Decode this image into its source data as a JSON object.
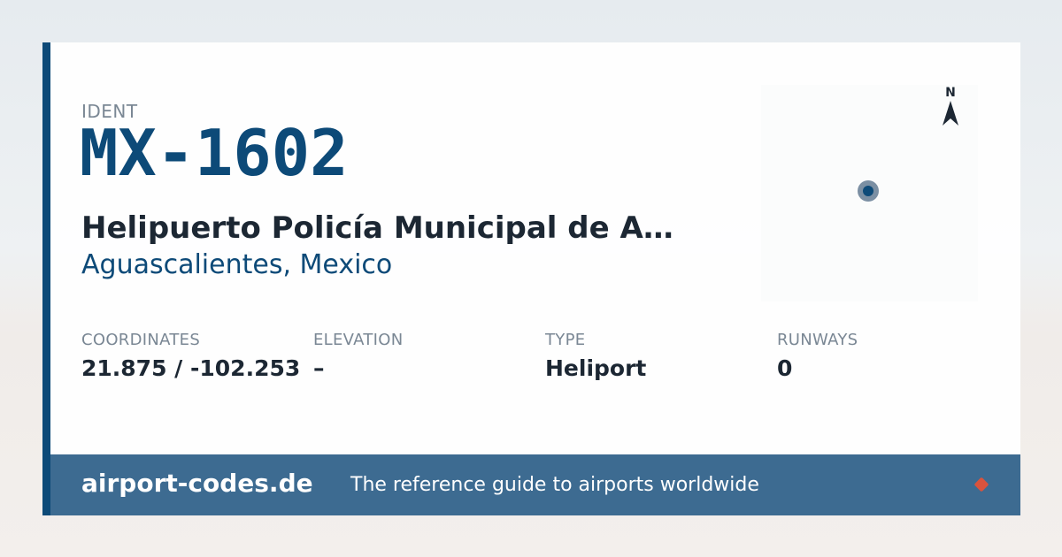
{
  "ident": {
    "label": "IDENT",
    "code": "MX-1602"
  },
  "airport": {
    "name": "Helipuerto Policía Municipal de A…",
    "location": "Aguascalientes, Mexico"
  },
  "map": {
    "compass_label": "N"
  },
  "stats": [
    {
      "label": "COORDINATES",
      "value": "21.875 / -102.253"
    },
    {
      "label": "ELEVATION",
      "value": "–"
    },
    {
      "label": "TYPE",
      "value": "Heliport"
    },
    {
      "label": "RUNWAYS",
      "value": "0"
    }
  ],
  "footer": {
    "brand": "airport-codes.de",
    "tagline": "The reference guide to airports worldwide"
  },
  "colors": {
    "accent": "#0d4a78",
    "footer_bg": "#3d6b91",
    "marker_dot": "#d9533d"
  }
}
